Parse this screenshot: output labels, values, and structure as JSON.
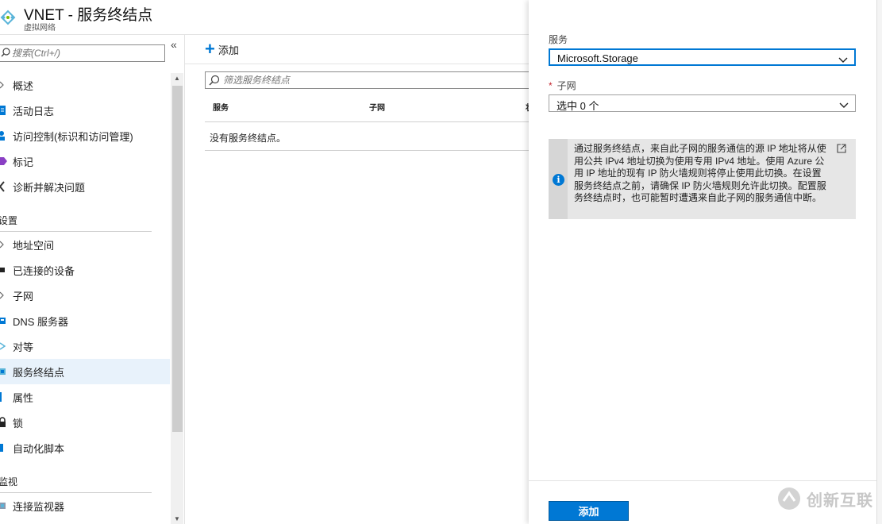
{
  "header": {
    "title": "VNET - 服务终结点",
    "subtitle": "虚拟网络"
  },
  "sidebar": {
    "search_placeholder": "搜索(Ctrl+/)",
    "collapse_glyph": "«",
    "items": [
      {
        "label": "概述",
        "icon": "chevron-icon"
      },
      {
        "label": "活动日志",
        "icon": "activity-log-icon"
      },
      {
        "label": "访问控制(标识和访问管理)",
        "icon": "access-control-icon"
      },
      {
        "label": "标记",
        "icon": "tag-icon"
      },
      {
        "label": "诊断并解决问题",
        "icon": "wrench-icon"
      }
    ],
    "section_settings": "设置",
    "settings_items": [
      {
        "label": "地址空间",
        "icon": "chevron-icon"
      },
      {
        "label": "已连接的设备",
        "icon": "plug-icon"
      },
      {
        "label": "子网",
        "icon": "chevron-icon"
      },
      {
        "label": "DNS 服务器",
        "icon": "dns-icon"
      },
      {
        "label": "对等",
        "icon": "peering-icon"
      },
      {
        "label": "服务终结点",
        "icon": "endpoint-icon"
      },
      {
        "label": "属性",
        "icon": "properties-icon"
      },
      {
        "label": "锁",
        "icon": "lock-icon"
      },
      {
        "label": "自动化脚本",
        "icon": "script-icon"
      }
    ],
    "section_monitor": "监视",
    "monitor_items": [
      {
        "label": "连接监视器",
        "icon": "monitor-icon"
      }
    ]
  },
  "toolbar": {
    "add_label": "添加"
  },
  "filter": {
    "placeholder": "筛选服务终结点"
  },
  "table": {
    "columns": [
      "服务",
      "子网",
      "状"
    ],
    "empty_message": "没有服务终结点。"
  },
  "blade": {
    "service_label": "服务",
    "service_value": "Microsoft.Storage",
    "subnet_required_mark": "*",
    "subnet_label": "子网",
    "subnet_value": "选中 0 个",
    "info_text": "通过服务终结点，来自此子网的服务通信的源 IP 地址将从使用公共 IPv4 地址切换为使用专用 IPv4 地址。使用 Azure 公用 IP 地址的现有 IP 防火墙规则将停止使用此切换。在设置服务终结点之前，请确保 IP 防火墙规则允许此切换。配置服务终结点时，也可能暂时遭遇来自此子网的服务通信中断。",
    "info_icon_glyph": "i",
    "submit_label": "添加"
  },
  "watermark": {
    "text": "创新互联"
  },
  "colors": {
    "accent": "#0078d4",
    "active_bg": "#e8f2fb",
    "info_bg": "#e6e6e6",
    "required": "#c4262e"
  }
}
